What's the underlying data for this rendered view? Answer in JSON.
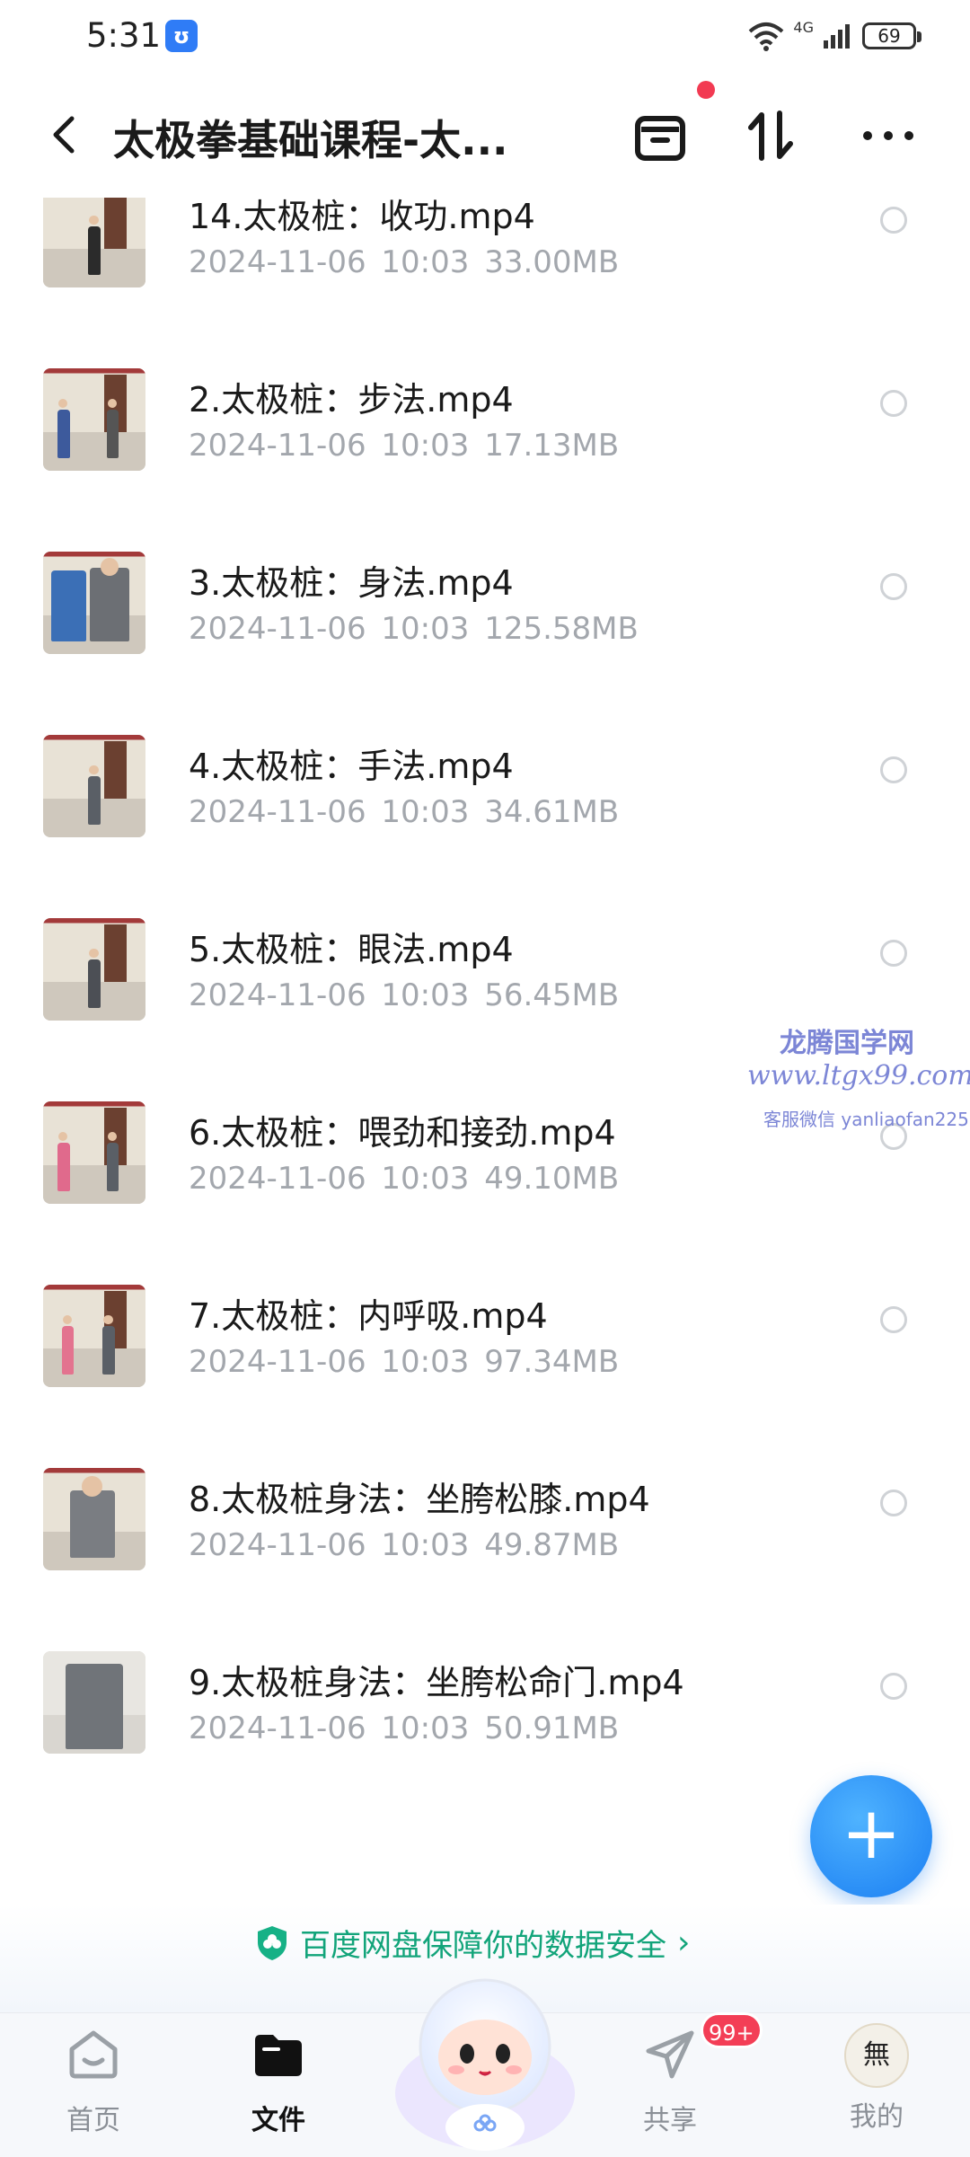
{
  "status_bar": {
    "time": "5:31",
    "app_badge": "ʊ",
    "network": "4G",
    "battery": "69"
  },
  "header": {
    "title": "太极拳基础课程-太..."
  },
  "files": [
    {
      "name": "14.太极桩：收功.mp4",
      "date": "2024-11-06",
      "time": "10:03",
      "size": "33.00MB"
    },
    {
      "name": "2.太极桩：步法.mp4",
      "date": "2024-11-06",
      "time": "10:03",
      "size": "17.13MB"
    },
    {
      "name": "3.太极桩：身法.mp4",
      "date": "2024-11-06",
      "time": "10:03",
      "size": "125.58MB"
    },
    {
      "name": "4.太极桩：手法.mp4",
      "date": "2024-11-06",
      "time": "10:03",
      "size": "34.61MB"
    },
    {
      "name": "5.太极桩：眼法.mp4",
      "date": "2024-11-06",
      "time": "10:03",
      "size": "56.45MB"
    },
    {
      "name": "6.太极桩：喂劲和接劲.mp4",
      "date": "2024-11-06",
      "time": "10:03",
      "size": "49.10MB"
    },
    {
      "name": "7.太极桩：内呼吸.mp4",
      "date": "2024-11-06",
      "time": "10:03",
      "size": "97.34MB"
    },
    {
      "name": "8.太极桩身法：坐胯松膝.mp4",
      "date": "2024-11-06",
      "time": "10:03",
      "size": "49.87MB"
    },
    {
      "name": "9.太极桩身法：坐胯松命门.mp4",
      "date": "2024-11-06",
      "time": "10:03",
      "size": "50.91MB"
    }
  ],
  "watermark": {
    "title": "龙腾国学网",
    "url": "www.ltgx99.com",
    "contact": "客服微信 yanliaofan225"
  },
  "fab": {
    "label": "+"
  },
  "security_banner": {
    "text": "百度网盘保障你的数据安全"
  },
  "nav": {
    "home": "首页",
    "files": "文件",
    "share": "共享",
    "share_badge": "99+",
    "mine": "我的"
  },
  "colors": {
    "accent": "#1a7ef2",
    "security_green": "#12a47a",
    "badge_red": "#f33e56",
    "meta_gray": "#a3a7ad"
  }
}
